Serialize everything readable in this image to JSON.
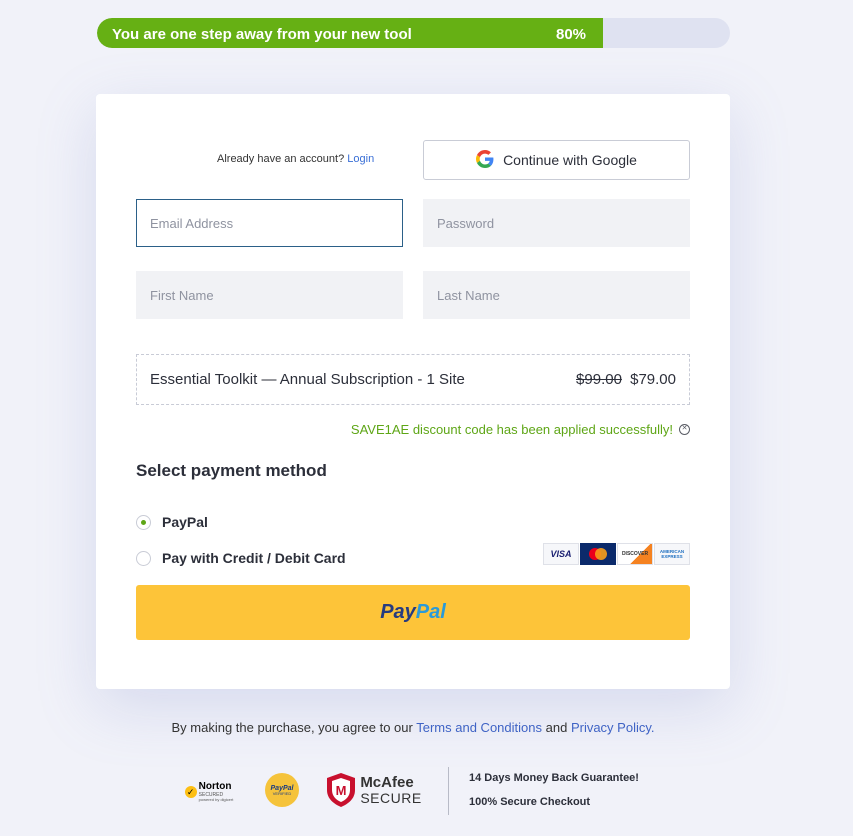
{
  "progress": {
    "text": "You are one step away from your new tool",
    "percent_label": "80%",
    "percent": 80,
    "color": "#66b014"
  },
  "account": {
    "prompt": "Already have an account?",
    "login_label": "Login"
  },
  "google_button": {
    "label": "Continue with Google"
  },
  "form": {
    "email_placeholder": "Email Address",
    "password_placeholder": "Password",
    "first_name_placeholder": "First Name",
    "last_name_placeholder": "Last Name"
  },
  "order": {
    "product": "Essential Toolkit — Annual Subscription - 1 Site",
    "old_price": "$99.00",
    "price": "$79.00"
  },
  "discount": {
    "message": "SAVE1AE discount code has been applied successfully!",
    "color": "#5ea616"
  },
  "payment": {
    "title": "Select payment method",
    "options": [
      {
        "label": "PayPal",
        "selected": true
      },
      {
        "label": "Pay with Credit / Debit Card",
        "selected": false
      }
    ],
    "card_logos": [
      "VISA",
      "DISCOVER",
      "AMERICAN EXPRESS"
    ]
  },
  "paypal_button": {
    "label_part1": "Pay",
    "label_part2": "Pal",
    "color": "#fdc439"
  },
  "legal": {
    "prefix": "By making the purchase, you agree to our",
    "terms_label": "Terms and Conditions",
    "conjunction": "and",
    "privacy_label": "Privacy Policy."
  },
  "badges": {
    "norton": "Norton",
    "norton_sub": "SECURED",
    "norton_powered": "powered by digicert",
    "paypal_verified": "PayPal",
    "paypal_verified_sub": "VERIFIED",
    "mcafee": "McAfee",
    "mcafee_sub": "SECURE"
  },
  "guarantee": {
    "line1": "14 Days Money Back Guarantee!",
    "line2": "100% Secure Checkout"
  }
}
